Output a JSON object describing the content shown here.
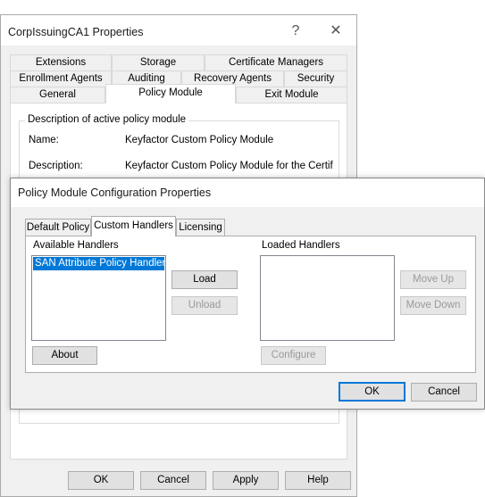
{
  "properties": {
    "title": "CorpIssuingCA1 Properties",
    "help_glyph": "?",
    "close_glyph": "✕",
    "tabs_row1": [
      "Extensions",
      "Storage",
      "Certificate Managers"
    ],
    "tabs_row2": [
      "Enrollment Agents",
      "Auditing",
      "Recovery Agents",
      "Security"
    ],
    "tabs_row3": [
      "General",
      "Policy Module",
      "Exit Module"
    ],
    "group_title": "Description of active policy module",
    "name_label": "Name:",
    "name_value": "Keyfactor Custom Policy Module",
    "description_label": "Description:",
    "description_value": "Keyfactor Custom Policy Module for the Certificate",
    "buttons": {
      "ok": "OK",
      "cancel": "Cancel",
      "apply": "Apply",
      "help": "Help"
    }
  },
  "config": {
    "title": "Policy Module Configuration Properties",
    "tabs": [
      "Default Policy",
      "Custom Handlers",
      "Licensing"
    ],
    "active_tab": "Custom Handlers",
    "available_label": "Available Handlers",
    "available_items": [
      "SAN Attribute Policy Handler"
    ],
    "loaded_label": "Loaded Handlers",
    "loaded_items": [],
    "buttons": {
      "load": "Load",
      "unload": "Unload",
      "about": "About",
      "configure": "Configure",
      "move_up": "Move Up",
      "move_down": "Move Down",
      "ok": "OK",
      "cancel": "Cancel"
    }
  }
}
